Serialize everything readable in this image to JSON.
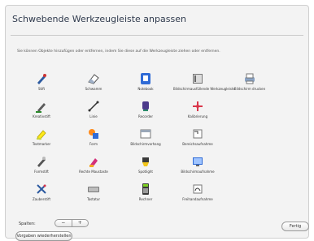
{
  "dialog": {
    "title": "Schwebende Werkzeugleiste anpassen",
    "instructions": "Sie können Objekte hinzufügen oder entfernen, indem Sie diese auf die Werkzeugleiste ziehen oder entfernen."
  },
  "tools": [
    {
      "label": "Stift",
      "icon": "pen-icon"
    },
    {
      "label": "Schwamm",
      "icon": "eraser-icon"
    },
    {
      "label": "Notebook",
      "icon": "notebook-icon"
    },
    {
      "label": "Bildschirmausfüllende Werkzeugleiste",
      "icon": "fullscreen-toolbar-icon"
    },
    {
      "label": "Bildschirm drucken",
      "icon": "print-screen-icon"
    },
    {
      "label": "Kreativstift",
      "icon": "creative-pen-icon"
    },
    {
      "label": "Linie",
      "icon": "line-icon"
    },
    {
      "label": "Recorder",
      "icon": "recorder-icon"
    },
    {
      "label": "Kalibrierung",
      "icon": "calibration-icon"
    },
    {
      "label": "Textmarker",
      "icon": "highlighter-icon"
    },
    {
      "label": "Form",
      "icon": "shape-icon"
    },
    {
      "label": "Bildschirmvorhang",
      "icon": "screen-shade-icon"
    },
    {
      "label": "Bereichsaufnahme",
      "icon": "area-capture-icon"
    },
    {
      "label": "Formstift",
      "icon": "shape-pen-icon"
    },
    {
      "label": "Rechte Maustaste",
      "icon": "right-click-icon"
    },
    {
      "label": "Spotlight",
      "icon": "spotlight-icon"
    },
    {
      "label": "Bildschirmaufnahme",
      "icon": "screen-capture-icon"
    },
    {
      "label": "Zauberstift",
      "icon": "magic-pen-icon"
    },
    {
      "label": "Tastatur",
      "icon": "keyboard-icon"
    },
    {
      "label": "Rechner",
      "icon": "calculator-icon"
    },
    {
      "label": "Freihandaufnahme",
      "icon": "freehand-capture-icon"
    }
  ],
  "footer": {
    "columns_label": "Spalten:",
    "decrease": "−",
    "increase": "+",
    "restore_label": "Vorgaben wiederherstellen",
    "done_label": "Fertig"
  }
}
